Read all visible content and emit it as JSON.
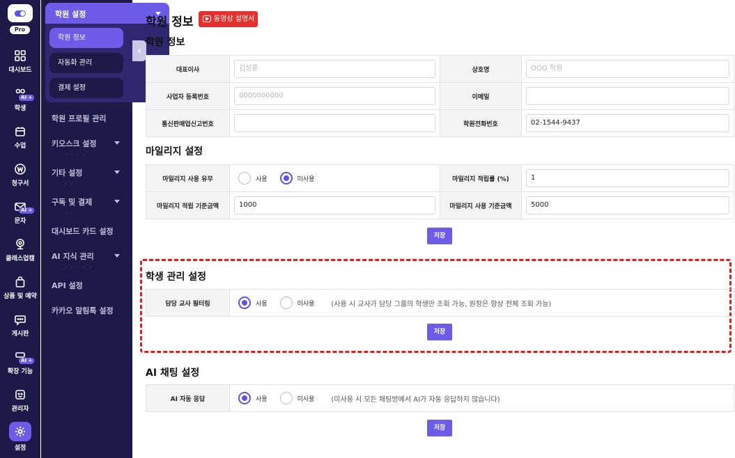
{
  "rail": {
    "pro_label": "Pro",
    "ai_tag": "AI +",
    "items": [
      {
        "label": "대시보드",
        "icon": "grid-icon"
      },
      {
        "label": "학생",
        "icon": "users-icon"
      },
      {
        "label": "수업",
        "icon": "calendar-icon"
      },
      {
        "label": "청구서",
        "icon": "won-icon"
      },
      {
        "label": "문자",
        "icon": "mail-icon"
      },
      {
        "label": "클래스업캠",
        "icon": "webcam-icon"
      },
      {
        "label": "상품 및 예약",
        "icon": "bag-icon"
      },
      {
        "label": "게시판",
        "icon": "chat-icon"
      },
      {
        "label": "확장 기능",
        "icon": "extension-icon"
      },
      {
        "label": "관리자",
        "icon": "admin-icon"
      },
      {
        "label": "설정",
        "icon": "gear-icon"
      }
    ]
  },
  "subnav": {
    "group_title": "학원 설정",
    "group_items": [
      "학원 정보",
      "자동화 관리",
      "결제 설정"
    ],
    "links": [
      "학원 프로필 관리",
      "키오스크 설정",
      "기타 설정",
      "구독 및 결제",
      "대시보드 카드 설정",
      "AI 지식 관리",
      "API 설정",
      "카카오 알림톡 설정"
    ]
  },
  "page": {
    "title": "학원 정보",
    "video_button": "동영상 설명서"
  },
  "academy_info": {
    "title": "학원 정보",
    "rows": [
      {
        "label1": "대표이사",
        "placeholder1": "김성훈",
        "value1": "",
        "label2": "상호명",
        "placeholder2": "OOO 학원",
        "value2": ""
      },
      {
        "label1": "사업자 등록번호",
        "placeholder1": "0000000000",
        "value1": "",
        "label2": "이메일",
        "placeholder2": "",
        "value2": ""
      },
      {
        "label1": "통신판매업신고번호",
        "placeholder1": "",
        "value1": "",
        "label2": "학원전화번호",
        "placeholder2": "",
        "value2": "02-1544-9437"
      }
    ]
  },
  "mileage": {
    "title": "마일리지 설정",
    "use_label": "마일리지 사용 유무",
    "option_use": "사용",
    "option_nouse": "미사용",
    "selected": "미사용",
    "rate_label": "마일리지 적립률 (%)",
    "rate_value": "1",
    "earn_base_label": "마일리지 적립 기준금액",
    "earn_base_value": "1000",
    "use_base_label": "마일리지 사용 기준금액",
    "use_base_value": "5000",
    "save": "저장"
  },
  "student": {
    "title": "학생 관리 설정",
    "filter_label": "담당 교사 필터링",
    "option_use": "사용",
    "option_nouse": "미사용",
    "selected": "사용",
    "help": "(사용 시 교사가 담당 그룹의 학생만 조회 가능, 원장은 항상 전체 조회 가능)",
    "save": "저장"
  },
  "ai_chat": {
    "title": "AI 채팅 설정",
    "auto_label": "AI 자동 응답",
    "option_use": "사용",
    "option_nouse": "미사용",
    "selected": "사용",
    "help": "(미사용 시 모든 채팅방에서 AI가 자동 응답하지 않습니다)",
    "save": "저장"
  },
  "colors": {
    "sidebar_bg": "#1d1a4a",
    "accent": "#6c5ce7",
    "video_red": "#e5322f",
    "highlight_red": "#e51c1c"
  }
}
